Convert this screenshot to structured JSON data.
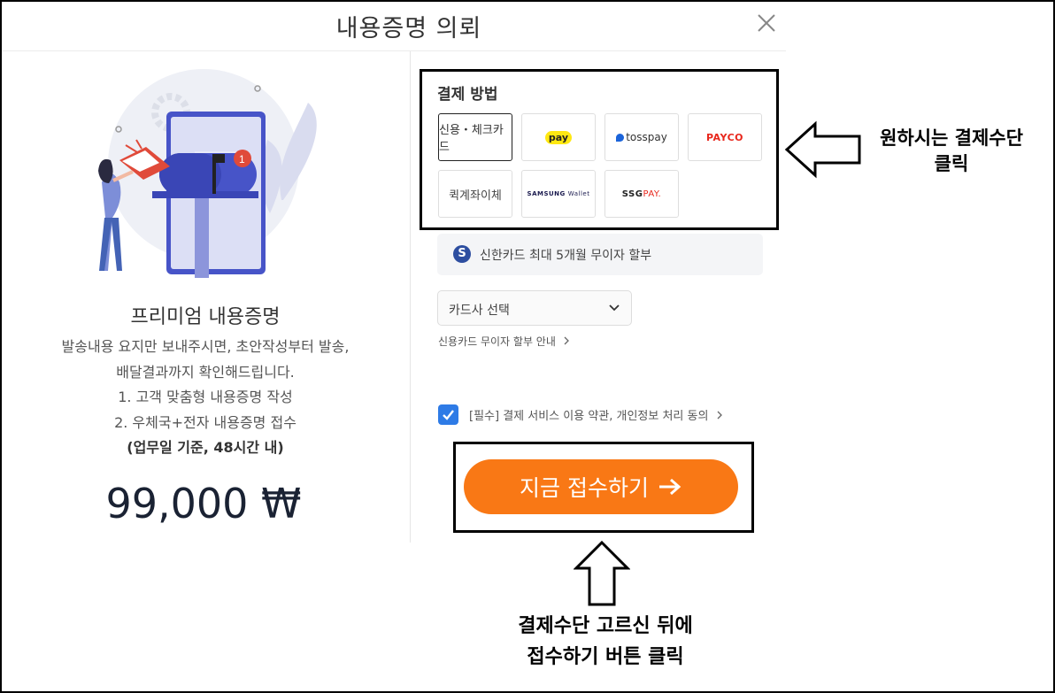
{
  "modal": {
    "title": "내용증명 의뢰"
  },
  "product": {
    "title": "프리미엄 내용증명",
    "desc_line1": "발송내용 요지만 보내주시면, 초안작성부터 발송,",
    "desc_line2": "배달결과까지 확인해드립니다.",
    "desc_line3": "1. 고객 맞춤형 내용증명 작성",
    "desc_line4": "2. 우체국+전자 내용증명 접수",
    "desc_line5": "(업무일 기준, 48시간 내)",
    "price": "99,000 ₩",
    "mail_badge": "1"
  },
  "payment": {
    "title": "결제 방법",
    "methods": {
      "card": "신용・체크카드",
      "kakao": "pay",
      "toss": "tosspay",
      "payco": "PAYCO",
      "transfer": "퀵계좌이체",
      "samsung_brand": "SAMSUNG",
      "samsung_wallet": "Wallet",
      "ssg_prefix": "SSG",
      "ssg_suffix": "PAY."
    },
    "selected": "card",
    "promo_text": "신한카드 최대 5개월 무이자 할부",
    "promo_icon": "S",
    "card_select_label": "카드사 선택",
    "installment_link": "신용카드 무이자 할부 안내",
    "agree_text": "[필수] 결제 서비스 이용 약관, 개인정보 처리 동의",
    "agree_checked": true,
    "submit_label": "지금 접수하기"
  },
  "annotations": {
    "right_line1": "원하시는 결제수단",
    "right_line2": "클릭",
    "bottom_line1": "결제수단 고르신 뒤에",
    "bottom_line2": "접수하기 버튼 클릭"
  },
  "colors": {
    "accent": "#f97815",
    "checkbox": "#2e7be6",
    "payco": "#e8271c",
    "kakao": "#ffe812",
    "toss": "#1b64da"
  }
}
